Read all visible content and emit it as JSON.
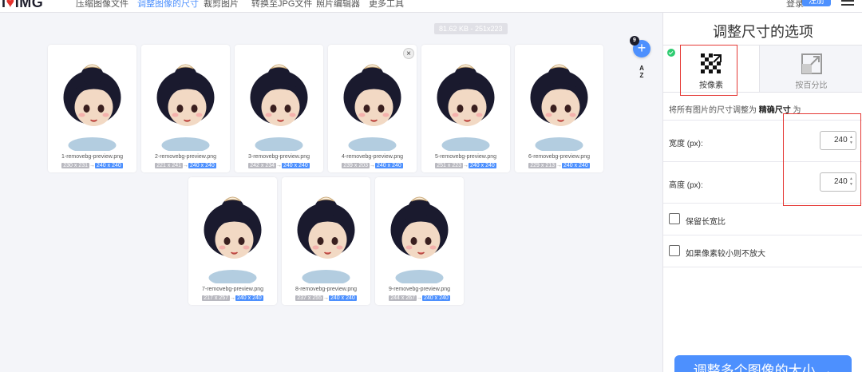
{
  "nav": {
    "logo_prefix": "I",
    "logo_heart": "♥",
    "logo_suffix": "IMG",
    "items": [
      "压缩图像文件",
      "调整图像的尺寸",
      "裁剪图片",
      "转换至JPG文件",
      "照片编辑器",
      "更多工具"
    ],
    "active_index": 1,
    "login": "登录",
    "signup": "注册"
  },
  "workspace": {
    "size_tooltip": "81.62 KB - 251x223",
    "file_count": "9",
    "add_label": "+",
    "sort_label_top": "A",
    "sort_label_bottom": "Z",
    "remove_label": "×",
    "target_size": "240 x 240",
    "files": [
      {
        "name": "1-removebg-preview.png",
        "orig": "230 x 231"
      },
      {
        "name": "2-removebg-preview.png",
        "orig": "221 x 241"
      },
      {
        "name": "3-removebg-preview.png",
        "orig": "242 x 234"
      },
      {
        "name": "4-removebg-preview.png",
        "orig": "239 x 203"
      },
      {
        "name": "5-removebg-preview.png",
        "orig": "251 x 223"
      },
      {
        "name": "6-removebg-preview.png",
        "orig": "229 x 213"
      },
      {
        "name": "7-removebg-preview.png",
        "orig": "217 x 257"
      },
      {
        "name": "8-removebg-preview.png",
        "orig": "237 x 255"
      },
      {
        "name": "9-removebg-preview.png",
        "orig": "244 x 267"
      }
    ]
  },
  "sidebar": {
    "title": "调整尺寸的选项",
    "tab_pixels": "按像素",
    "tab_percent": "按百分比",
    "desc_prefix": "将所有图片的尺寸调整为 ",
    "desc_bold": "精确尺寸",
    "desc_suffix": " 为",
    "width_label": "宽度 (px):",
    "width_value": "240",
    "height_label": "高度 (px):",
    "height_value": "240",
    "keep_ratio_label": "保留长宽比",
    "no_enlarge_label": "如果像素较小则不放大",
    "submit_label": "调整多个图像的大小 →"
  },
  "colors": {
    "accent": "#4d90fe",
    "highlight": "#e53935",
    "success": "#2ecc71"
  }
}
